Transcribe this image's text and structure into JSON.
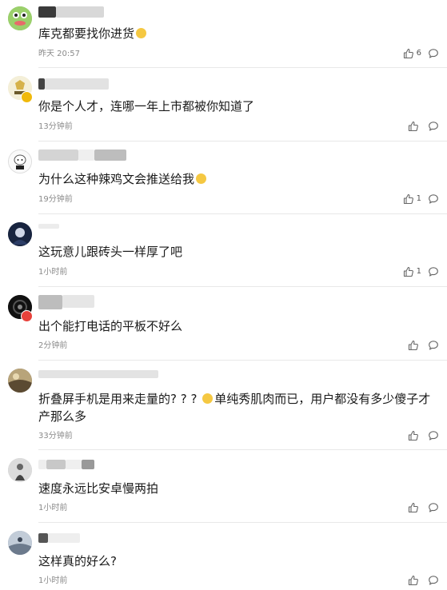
{
  "comments": [
    {
      "username": "",
      "text": "库克都要找你进货",
      "emoji": "smile-emoji",
      "time": "昨天 20:57",
      "likes": "6",
      "avatar_color": "#7dbb56"
    },
    {
      "username": "",
      "text": "你是个人才，连哪一年上市都被你知道了",
      "emoji": "",
      "time": "13分钟前",
      "likes": "",
      "avatar_color": "#d6b24a"
    },
    {
      "username": "",
      "text": "为什么这种辣鸡文会推送给我",
      "emoji": "laugh-cry-emoji",
      "time": "19分钟前",
      "likes": "1",
      "avatar_color": "#e8e8e8"
    },
    {
      "username": "",
      "text": "这玩意儿跟砖头一样厚了吧",
      "emoji": "",
      "time": "1小时前",
      "likes": "1",
      "avatar_color": "#1c2a4a"
    },
    {
      "username": "",
      "text": "出个能打电话的平板不好么",
      "emoji": "",
      "time": "2分钟前",
      "likes": "",
      "avatar_color": "#101010"
    },
    {
      "username": "",
      "text": "折叠屏手机是用来走量的? ? ? ",
      "text2": "单纯秀肌肉而已，用户都没有多少傻子才",
      "text3": "产那么多",
      "emoji": "sweat-emoji",
      "time": "33分钟前",
      "likes": "",
      "avatar_color": "#8a7a60"
    },
    {
      "username": "",
      "text": "速度永远比安卓慢两拍",
      "emoji": "",
      "time": "1小时前",
      "likes": "",
      "avatar_color": "#c9c9c9"
    },
    {
      "username": "",
      "text": "这样真的好么?",
      "emoji": "",
      "time": "1小时前",
      "likes": "",
      "avatar_color": "#9aa6b8"
    }
  ]
}
